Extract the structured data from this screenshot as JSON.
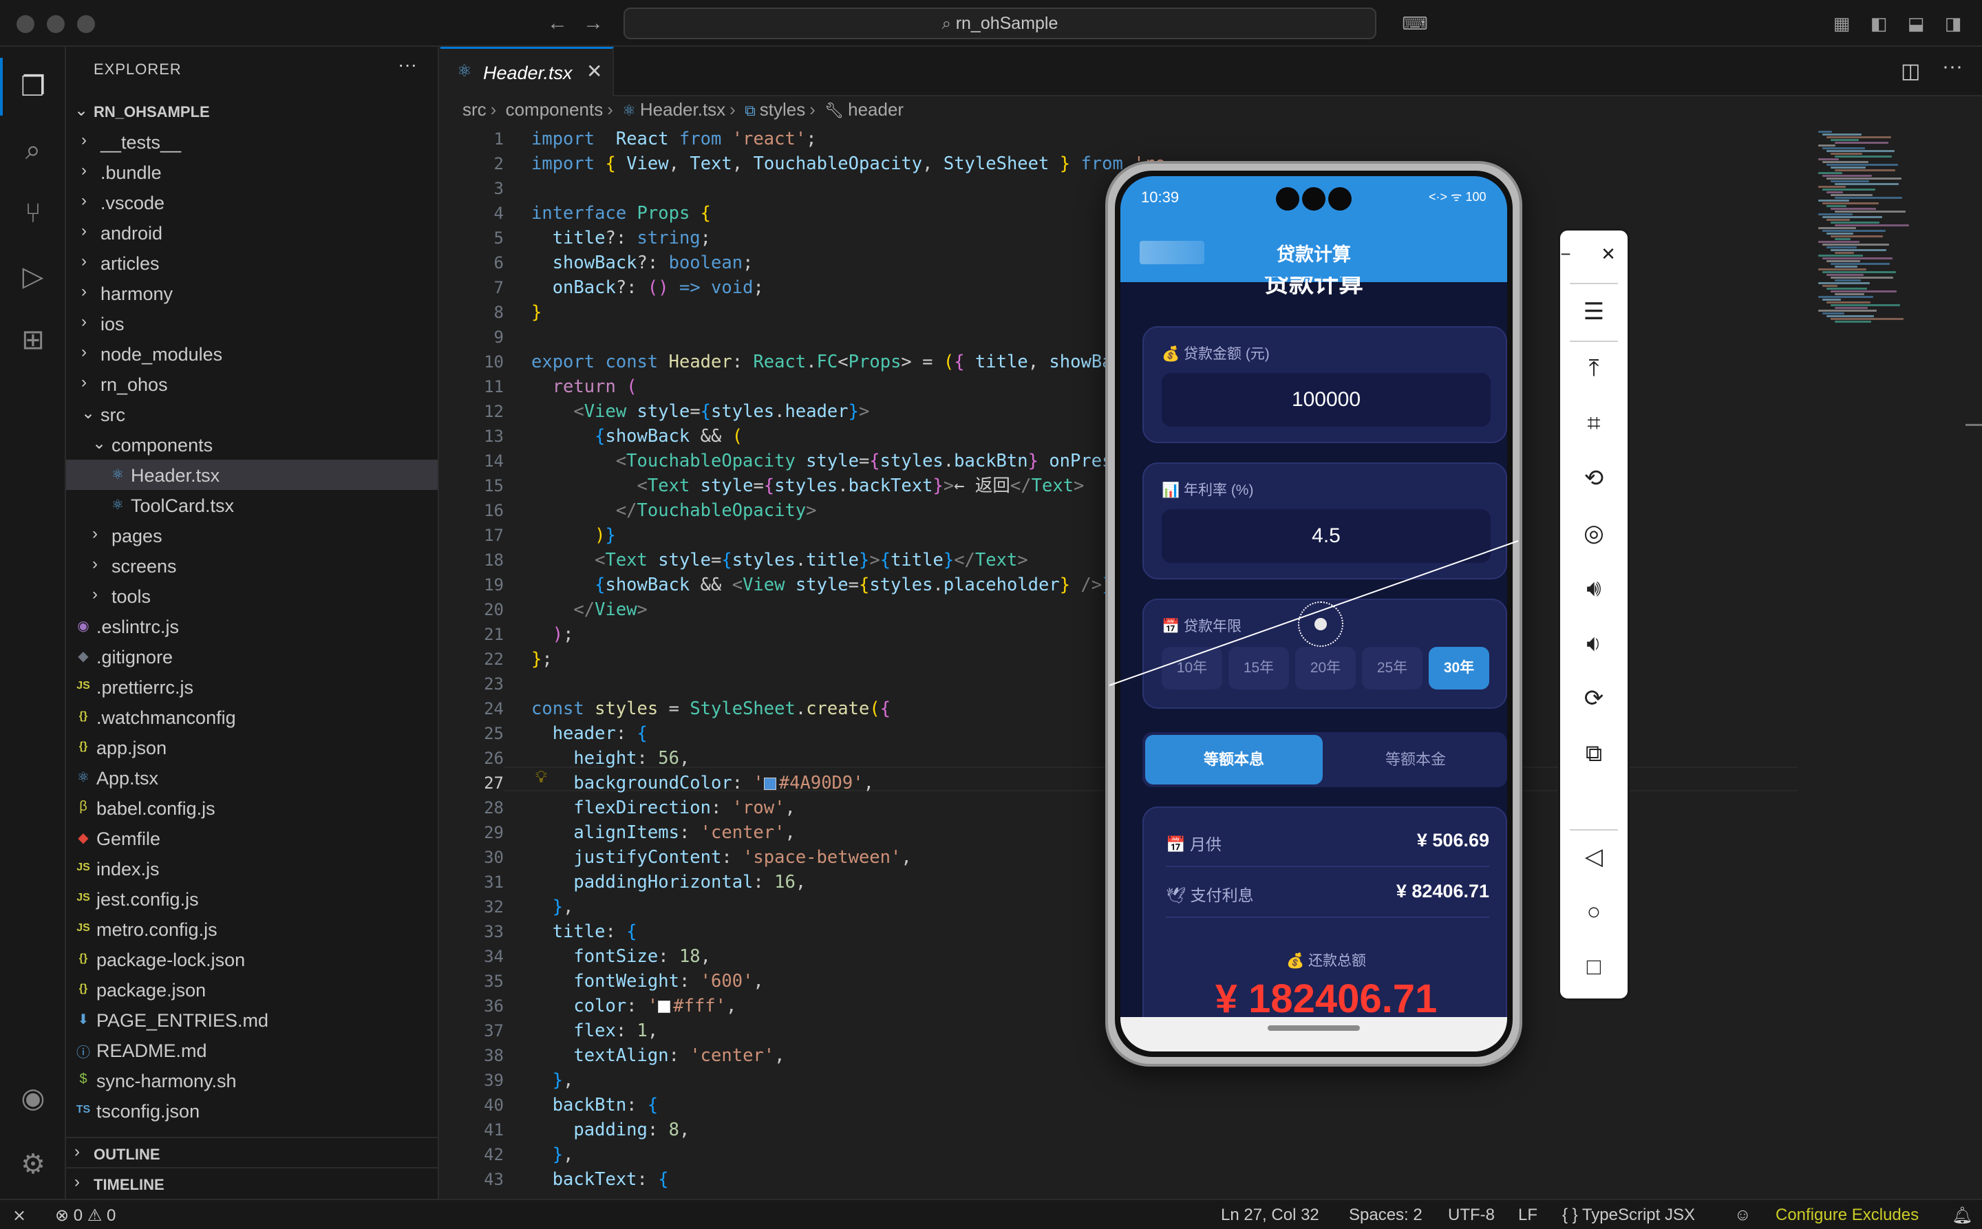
{
  "window": {
    "search": "rn_ohSample"
  },
  "explorer": {
    "title": "EXPLORER",
    "root": "RN_OHSAMPLE",
    "items": [
      {
        "name": "__tests__",
        "kind": "folder",
        "depth": 1,
        "open": false,
        "icon": "folder"
      },
      {
        "name": ".bundle",
        "kind": "folder",
        "depth": 1,
        "open": false,
        "icon": "folder"
      },
      {
        "name": ".vscode",
        "kind": "folder",
        "depth": 1,
        "open": false,
        "icon": "folder"
      },
      {
        "name": "android",
        "kind": "folder",
        "depth": 1,
        "open": false,
        "icon": "folder"
      },
      {
        "name": "articles",
        "kind": "folder",
        "depth": 1,
        "open": false,
        "icon": "folder"
      },
      {
        "name": "harmony",
        "kind": "folder",
        "depth": 1,
        "open": false,
        "icon": "folder"
      },
      {
        "name": "ios",
        "kind": "folder",
        "depth": 1,
        "open": false,
        "icon": "folder"
      },
      {
        "name": "node_modules",
        "kind": "folder",
        "depth": 1,
        "open": false,
        "icon": "folder"
      },
      {
        "name": "rn_ohos",
        "kind": "folder",
        "depth": 1,
        "open": false,
        "icon": "folder"
      },
      {
        "name": "src",
        "kind": "folder",
        "depth": 1,
        "open": true,
        "icon": "folder"
      },
      {
        "name": "components",
        "kind": "folder",
        "depth": 2,
        "open": true,
        "icon": "folder"
      },
      {
        "name": "Header.tsx",
        "kind": "file",
        "depth": 3,
        "icon": "react",
        "selected": true
      },
      {
        "name": "ToolCard.tsx",
        "kind": "file",
        "depth": 3,
        "icon": "react"
      },
      {
        "name": "pages",
        "kind": "folder",
        "depth": 2,
        "open": false,
        "icon": "folder"
      },
      {
        "name": "screens",
        "kind": "folder",
        "depth": 2,
        "open": false,
        "icon": "folder"
      },
      {
        "name": "tools",
        "kind": "folder",
        "depth": 2,
        "open": false,
        "icon": "folder"
      },
      {
        "name": ".eslintrc.js",
        "kind": "file",
        "depth": 1,
        "icon": "eslint"
      },
      {
        "name": ".gitignore",
        "kind": "file",
        "depth": 1,
        "icon": "git"
      },
      {
        "name": ".prettierrc.js",
        "kind": "file",
        "depth": 1,
        "icon": "js"
      },
      {
        "name": ".watchmanconfig",
        "kind": "file",
        "depth": 1,
        "icon": "json"
      },
      {
        "name": "app.json",
        "kind": "file",
        "depth": 1,
        "icon": "json"
      },
      {
        "name": "App.tsx",
        "kind": "file",
        "depth": 1,
        "icon": "react"
      },
      {
        "name": "babel.config.js",
        "kind": "file",
        "depth": 1,
        "icon": "babel"
      },
      {
        "name": "Gemfile",
        "kind": "file",
        "depth": 1,
        "icon": "ruby"
      },
      {
        "name": "index.js",
        "kind": "file",
        "depth": 1,
        "icon": "js"
      },
      {
        "name": "jest.config.js",
        "kind": "file",
        "depth": 1,
        "icon": "js"
      },
      {
        "name": "metro.config.js",
        "kind": "file",
        "depth": 1,
        "icon": "js"
      },
      {
        "name": "package-lock.json",
        "kind": "file",
        "depth": 1,
        "icon": "json"
      },
      {
        "name": "package.json",
        "kind": "file",
        "depth": 1,
        "icon": "json"
      },
      {
        "name": "PAGE_ENTRIES.md",
        "kind": "file",
        "depth": 1,
        "icon": "md"
      },
      {
        "name": "README.md",
        "kind": "file",
        "depth": 1,
        "icon": "info"
      },
      {
        "name": "sync-harmony.sh",
        "kind": "file",
        "depth": 1,
        "icon": "sh"
      },
      {
        "name": "tsconfig.json",
        "kind": "file",
        "depth": 1,
        "icon": "ts"
      }
    ],
    "outline": "OUTLINE",
    "timeline": "TIMELINE"
  },
  "editor": {
    "tab": "Header.tsx",
    "breadcrumb": [
      "src",
      "components",
      "Header.tsx",
      "styles",
      "header"
    ],
    "current_line": 27,
    "first_line": 1,
    "lines": [
      [
        [
          "kw",
          "import"
        ],
        [
          "",
          "  "
        ],
        [
          "var",
          "React"
        ],
        [
          "",
          " "
        ],
        [
          "kw",
          "from"
        ],
        [
          "",
          " "
        ],
        [
          "str",
          "'react'"
        ],
        [
          "",
          ";"
        ]
      ],
      [
        [
          "kw",
          "import"
        ],
        [
          "",
          " "
        ],
        [
          "br1",
          "{"
        ],
        [
          "",
          " "
        ],
        [
          "var",
          "View"
        ],
        [
          "",
          ", "
        ],
        [
          "var",
          "Text"
        ],
        [
          "",
          ", "
        ],
        [
          "var",
          "TouchableOpacity"
        ],
        [
          "",
          ", "
        ],
        [
          "var",
          "StyleSheet"
        ],
        [
          "",
          " "
        ],
        [
          "br1",
          "}"
        ],
        [
          "",
          " "
        ],
        [
          "kw",
          "from"
        ],
        [
          "",
          " "
        ],
        [
          "str",
          "'re"
        ]
      ],
      [],
      [
        [
          "kw",
          "interface"
        ],
        [
          "",
          " "
        ],
        [
          "typ",
          "Props"
        ],
        [
          "",
          " "
        ],
        [
          "br1",
          "{"
        ]
      ],
      [
        [
          "",
          ""
        ],
        [
          "var",
          "  title"
        ],
        [
          "",
          "?: "
        ],
        [
          "kw",
          "string"
        ],
        [
          "",
          ";"
        ]
      ],
      [
        [
          "var",
          "  showBack"
        ],
        [
          "",
          "?: "
        ],
        [
          "kw",
          "boolean"
        ],
        [
          "",
          ";"
        ]
      ],
      [
        [
          "var",
          "  onBack"
        ],
        [
          "",
          "?: "
        ],
        [
          "br2",
          "()"
        ],
        [
          "",
          " "
        ],
        [
          "kw",
          "=>"
        ],
        [
          "",
          " "
        ],
        [
          "kw",
          "void"
        ],
        [
          "",
          ";"
        ]
      ],
      [
        [
          "br1",
          "}"
        ]
      ],
      [],
      [
        [
          "kw",
          "export"
        ],
        [
          "",
          " "
        ],
        [
          "kw",
          "const"
        ],
        [
          "",
          " "
        ],
        [
          "fn",
          "Header"
        ],
        [
          "",
          ": "
        ],
        [
          "typ",
          "React"
        ],
        [
          "",
          "."
        ],
        [
          "typ",
          "FC"
        ],
        [
          "",
          ""
        ],
        [
          "",
          "<"
        ],
        [
          "typ",
          "Props"
        ],
        [
          "",
          "> = "
        ],
        [
          "br1",
          "("
        ],
        [
          "br2",
          "{"
        ],
        [
          "",
          " "
        ],
        [
          "var",
          "title"
        ],
        [
          "",
          ", "
        ],
        [
          "var",
          "showBack"
        ]
      ],
      [
        [
          "ctl",
          "  return"
        ],
        [
          "",
          " "
        ],
        [
          "br2",
          "("
        ]
      ],
      [
        [
          "pun",
          "    <"
        ],
        [
          "tag",
          "View"
        ],
        [
          "",
          " "
        ],
        [
          "var",
          "style"
        ],
        [
          "",
          "="
        ],
        [
          "br3",
          "{"
        ],
        [
          "var",
          "styles"
        ],
        [
          "",
          "."
        ],
        [
          "var",
          "header"
        ],
        [
          "br3",
          "}"
        ],
        [
          "pun",
          ">"
        ]
      ],
      [
        [
          "br3",
          "      {"
        ],
        [
          "var",
          "showBack"
        ],
        [
          "",
          " && "
        ],
        [
          "br1",
          "("
        ]
      ],
      [
        [
          "pun",
          "        <"
        ],
        [
          "tag",
          "TouchableOpacity"
        ],
        [
          "",
          " "
        ],
        [
          "var",
          "style"
        ],
        [
          "",
          "="
        ],
        [
          "br2",
          "{"
        ],
        [
          "var",
          "styles"
        ],
        [
          "",
          "."
        ],
        [
          "var",
          "backBtn"
        ],
        [
          "br2",
          "}"
        ],
        [
          "",
          " "
        ],
        [
          "var",
          "onPress"
        ],
        [
          "",
          "="
        ]
      ],
      [
        [
          "pun",
          "          <"
        ],
        [
          "tag",
          "Text"
        ],
        [
          "",
          " "
        ],
        [
          "var",
          "style"
        ],
        [
          "",
          "="
        ],
        [
          "br2",
          "{"
        ],
        [
          "var",
          "styles"
        ],
        [
          "",
          "."
        ],
        [
          "var",
          "backText"
        ],
        [
          "br2",
          "}"
        ],
        [
          "pun",
          ">"
        ],
        [
          "",
          "← 返回"
        ],
        [
          "pun",
          "</"
        ],
        [
          "tag",
          "Text"
        ],
        [
          "pun",
          ">"
        ]
      ],
      [
        [
          "pun",
          "        </"
        ],
        [
          "tag",
          "TouchableOpacity"
        ],
        [
          "pun",
          ">"
        ]
      ],
      [
        [
          "br1",
          "      )"
        ],
        [
          "br3",
          "}"
        ]
      ],
      [
        [
          "pun",
          "      <"
        ],
        [
          "tag",
          "Text"
        ],
        [
          "",
          " "
        ],
        [
          "var",
          "style"
        ],
        [
          "",
          "="
        ],
        [
          "br3",
          "{"
        ],
        [
          "var",
          "styles"
        ],
        [
          "",
          "."
        ],
        [
          "var",
          "title"
        ],
        [
          "br3",
          "}"
        ],
        [
          "pun",
          ">"
        ],
        [
          "br3",
          "{"
        ],
        [
          "var",
          "title"
        ],
        [
          "br3",
          "}"
        ],
        [
          "pun",
          "</"
        ],
        [
          "tag",
          "Text"
        ],
        [
          "pun",
          ">"
        ]
      ],
      [
        [
          "br3",
          "      {"
        ],
        [
          "var",
          "showBack"
        ],
        [
          "",
          " && "
        ],
        [
          "pun",
          "<"
        ],
        [
          "tag",
          "View"
        ],
        [
          "",
          " "
        ],
        [
          "var",
          "style"
        ],
        [
          "",
          "="
        ],
        [
          "br1",
          "{"
        ],
        [
          "var",
          "styles"
        ],
        [
          "",
          "."
        ],
        [
          "var",
          "placeholder"
        ],
        [
          "br1",
          "}"
        ],
        [
          "pun",
          " />"
        ],
        [
          "br3",
          "}"
        ]
      ],
      [
        [
          "pun",
          "    </"
        ],
        [
          "tag",
          "View"
        ],
        [
          "pun",
          ">"
        ]
      ],
      [
        [
          "br2",
          "  )"
        ],
        [
          "",
          ";"
        ]
      ],
      [
        [
          "br1",
          "}"
        ],
        [
          "",
          ";"
        ]
      ],
      [],
      [
        [
          "kw",
          "const"
        ],
        [
          "",
          " "
        ],
        [
          "fn",
          "styles"
        ],
        [
          "",
          " = "
        ],
        [
          "typ",
          "StyleSheet"
        ],
        [
          "",
          "."
        ],
        [
          "fn",
          "create"
        ],
        [
          "br1",
          "("
        ],
        [
          "br2",
          "{"
        ]
      ],
      [
        [
          "var",
          "  header"
        ],
        [
          "",
          ": "
        ],
        [
          "br3",
          "{"
        ]
      ],
      [
        [
          "var",
          "    height"
        ],
        [
          "",
          ": "
        ],
        [
          "num",
          "56"
        ],
        [
          "",
          ","
        ]
      ],
      [
        [
          "var",
          "    backgroundColor"
        ],
        [
          "",
          ": "
        ],
        [
          "str",
          "'"
        ],
        [
          "swatch",
          "#4A90D9"
        ],
        [
          "str",
          "#4A90D9'"
        ],
        [
          "",
          ","
        ]
      ],
      [
        [
          "var",
          "    flexDirection"
        ],
        [
          "",
          ": "
        ],
        [
          "str",
          "'row'"
        ],
        [
          "",
          ","
        ]
      ],
      [
        [
          "var",
          "    alignItems"
        ],
        [
          "",
          ": "
        ],
        [
          "str",
          "'center'"
        ],
        [
          "",
          ","
        ]
      ],
      [
        [
          "var",
          "    justifyContent"
        ],
        [
          "",
          ": "
        ],
        [
          "str",
          "'space-between'"
        ],
        [
          "",
          ","
        ]
      ],
      [
        [
          "var",
          "    paddingHorizontal"
        ],
        [
          "",
          ": "
        ],
        [
          "num",
          "16"
        ],
        [
          "",
          ","
        ]
      ],
      [
        [
          "br3",
          "  }"
        ],
        [
          "",
          ","
        ]
      ],
      [
        [
          "var",
          "  title"
        ],
        [
          "",
          ": "
        ],
        [
          "br3",
          "{"
        ]
      ],
      [
        [
          "var",
          "    fontSize"
        ],
        [
          "",
          ": "
        ],
        [
          "num",
          "18"
        ],
        [
          "",
          ","
        ]
      ],
      [
        [
          "var",
          "    fontWeight"
        ],
        [
          "",
          ": "
        ],
        [
          "str",
          "'600'"
        ],
        [
          "",
          ","
        ]
      ],
      [
        [
          "var",
          "    color"
        ],
        [
          "",
          ": "
        ],
        [
          "str",
          "'"
        ],
        [
          "swatch",
          "#ffffff"
        ],
        [
          "str",
          "#fff'"
        ],
        [
          "",
          ","
        ]
      ],
      [
        [
          "var",
          "    flex"
        ],
        [
          "",
          ": "
        ],
        [
          "num",
          "1"
        ],
        [
          "",
          ","
        ]
      ],
      [
        [
          "var",
          "    textAlign"
        ],
        [
          "",
          ": "
        ],
        [
          "str",
          "'center'"
        ],
        [
          "",
          ","
        ]
      ],
      [
        [
          "br3",
          "  }"
        ],
        [
          "",
          ","
        ]
      ],
      [
        [
          "var",
          "  backBtn"
        ],
        [
          "",
          ": "
        ],
        [
          "br3",
          "{"
        ]
      ],
      [
        [
          "var",
          "    padding"
        ],
        [
          "",
          ": "
        ],
        [
          "num",
          "8"
        ],
        [
          "",
          ","
        ]
      ],
      [
        [
          "br3",
          "  }"
        ],
        [
          "",
          ","
        ]
      ],
      [
        [
          "var",
          "  backText"
        ],
        [
          "",
          ": "
        ],
        [
          "br3",
          "{"
        ]
      ]
    ]
  },
  "phone": {
    "time": "10:39",
    "status_right": "<·>  ᯤ 100",
    "app_title": "贷款计算",
    "page_heading": "贷款计算",
    "amount_label": "💰 贷款金额 (元)",
    "amount_value": "100000",
    "rate_label": "📊 年利率 (%)",
    "rate_value": "4.5",
    "years_label": "📅 贷款年限",
    "year_options": [
      "10年",
      "15年",
      "20年",
      "25年",
      "30年"
    ],
    "year_selected": "30年",
    "modes": [
      "等额本息",
      "等额本金"
    ],
    "mode_selected": "等额本息",
    "monthly_label": "📅 月供",
    "monthly_value": "¥ 506.69",
    "interest_label": "🕊 支付利息",
    "interest_value": "¥ 82406.71",
    "total_label": "💰 还款总额",
    "total_value": "¥ 182406.71",
    "colors": {
      "header": "#2b8fe0",
      "background": "#0f1535",
      "card": "#1d2456",
      "accent": "#2f8bd8",
      "total": "#ff3b30"
    }
  },
  "statusbar": {
    "errors": "0",
    "warnings": "0",
    "position": "Ln 27, Col 32",
    "spaces": "Spaces: 2",
    "encoding": "UTF-8",
    "eol": "LF",
    "language": "{ } TypeScript JSX",
    "configure": "Configure Excludes"
  }
}
